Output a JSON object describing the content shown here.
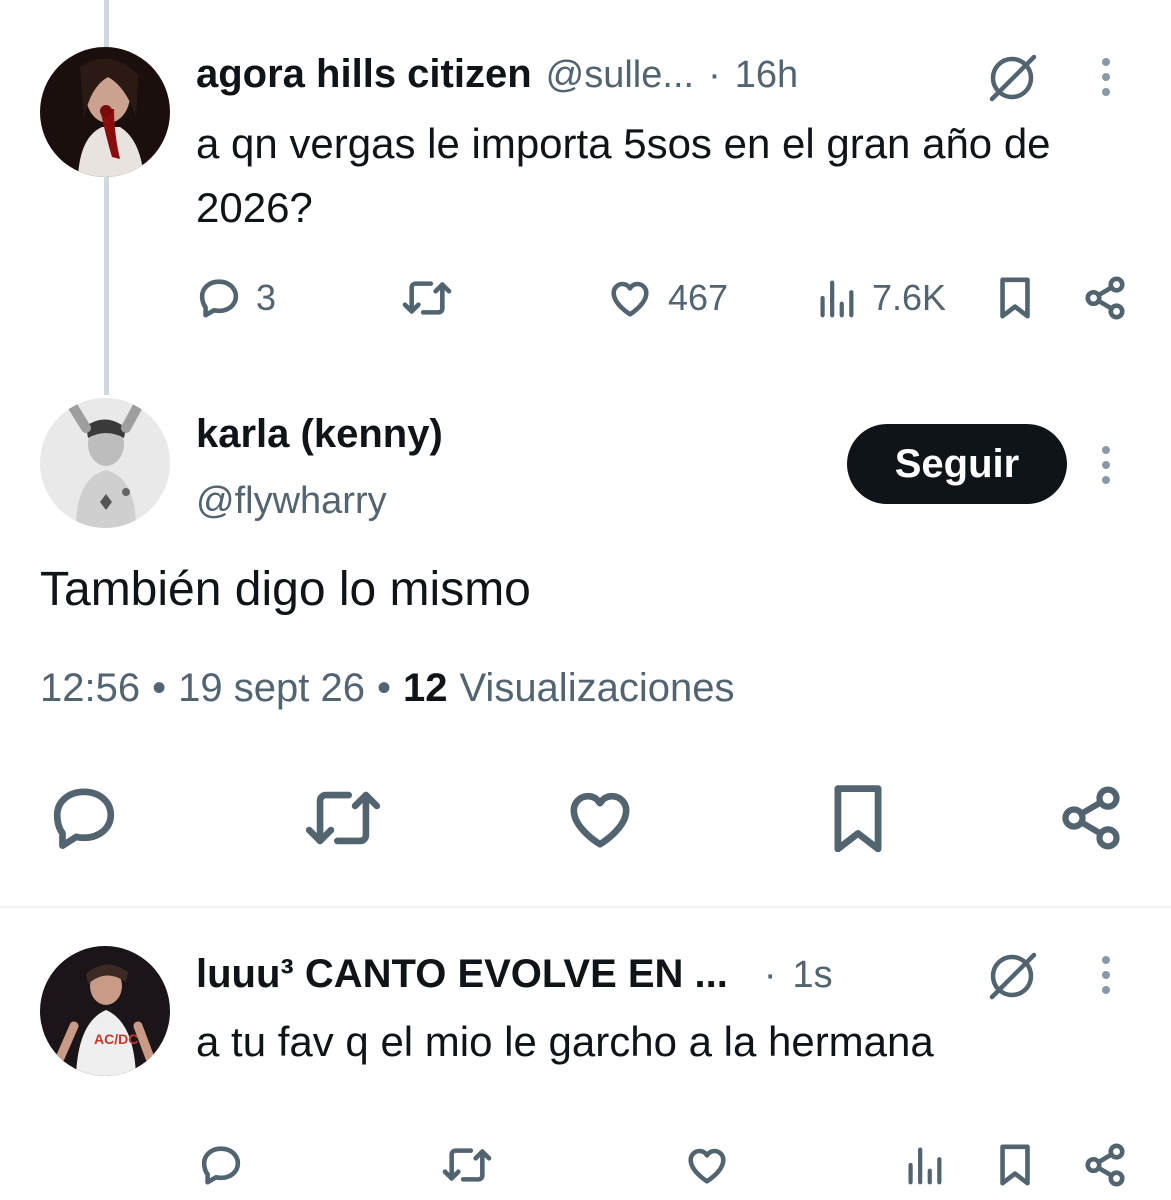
{
  "parent_tweet": {
    "display_name": "agora hills citizen",
    "handle": "@sulle...",
    "separator": "·",
    "time": "16h",
    "text": "a qn vergas le importa 5sos en el gran año de 2026?",
    "metrics": {
      "replies": "3",
      "likes": "467",
      "views": "7.6K"
    }
  },
  "main_tweet": {
    "display_name": "karla (kenny)",
    "handle": "@flywharry",
    "follow_label": "Seguir",
    "text": "También digo lo mismo",
    "time": "12:56",
    "date": "19 sept 26",
    "dot1": "•",
    "dot2": "•",
    "views_count": "12",
    "views_label": "Visualizaciones"
  },
  "reply_tweet": {
    "display_name": "luuu³ CANTO EVOLVE EN ...",
    "separator": "·",
    "time": "1s",
    "text": "a tu fav q el mio le garcho a la hermana"
  },
  "colors": {
    "text_primary": "#0f1419",
    "text_secondary": "#536471",
    "thread_line": "#cfd9de",
    "button_bg": "#0f1419"
  },
  "icons": [
    "reply-icon",
    "repost-icon",
    "like-icon",
    "views-icon",
    "bookmark-icon",
    "share-icon",
    "grok-icon",
    "more-icon"
  ]
}
